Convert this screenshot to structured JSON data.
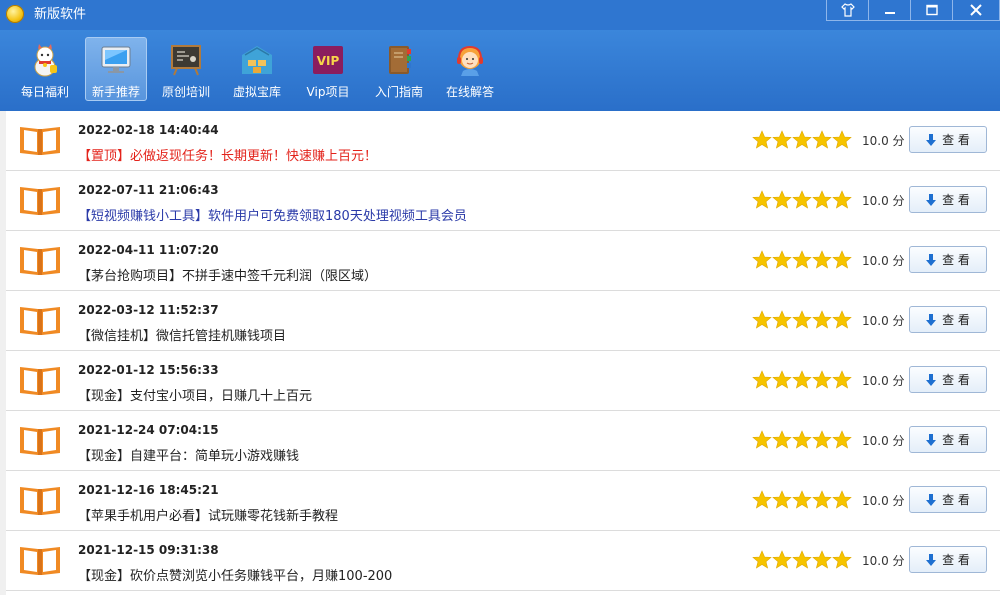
{
  "window": {
    "title": "新版软件",
    "buttons": [
      "skin-icon",
      "minimize-icon",
      "maximize-icon",
      "close-icon"
    ]
  },
  "toolbar": {
    "items": [
      {
        "label": "每日福利",
        "icon": "lucky-cat-icon",
        "active": false
      },
      {
        "label": "新手推荐",
        "icon": "monitor-icon",
        "active": true
      },
      {
        "label": "原创培训",
        "icon": "blackboard-icon",
        "active": false
      },
      {
        "label": "虚拟宝库",
        "icon": "warehouse-icon",
        "active": false
      },
      {
        "label": "Vip项目",
        "icon": "vip-icon",
        "active": false
      },
      {
        "label": "入门指南",
        "icon": "book-stack-icon",
        "active": false
      },
      {
        "label": "在线解答",
        "icon": "support-agent-icon",
        "active": false
      }
    ],
    "vip_text": "VIP"
  },
  "list": {
    "rows": [
      {
        "date": "2022-02-18 14:40:44",
        "title": "【置顶】必做返现任务！长期更新！快速赚上百元！",
        "color": "red",
        "rating": 5,
        "score": "10.0 分",
        "action": "查 看"
      },
      {
        "date": "2022-07-11 21:06:43",
        "title": "【短视频赚钱小工具】软件用户可免费领取180天处理视频工具会员",
        "color": "blue",
        "rating": 5,
        "score": "10.0 分",
        "action": "查 看"
      },
      {
        "date": "2022-04-11 11:07:20",
        "title": "【茅台抢购项目】不拼手速中签千元利润（限区域）",
        "color": "black",
        "rating": 5,
        "score": "10.0 分",
        "action": "查 看"
      },
      {
        "date": "2022-03-12 11:52:37",
        "title": "【微信挂机】微信托管挂机赚钱项目",
        "color": "black",
        "rating": 5,
        "score": "10.0 分",
        "action": "查 看"
      },
      {
        "date": "2022-01-12 15:56:33",
        "title": "【现金】支付宝小项目，日赚几十上百元",
        "color": "black",
        "rating": 5,
        "score": "10.0 分",
        "action": "查 看"
      },
      {
        "date": "2021-12-24 07:04:15",
        "title": "【现金】自建平台：简单玩小游戏赚钱",
        "color": "black",
        "rating": 5,
        "score": "10.0 分",
        "action": "查 看"
      },
      {
        "date": "2021-12-16 18:45:21",
        "title": "【苹果手机用户必看】试玩赚零花钱新手教程",
        "color": "black",
        "rating": 5,
        "score": "10.0 分",
        "action": "查 看"
      },
      {
        "date": "2021-12-15 09:31:38",
        "title": "【现金】砍价点赞浏览小任务赚钱平台，月赚100-200",
        "color": "black",
        "rating": 5,
        "score": "10.0 分",
        "action": "查 看"
      }
    ]
  },
  "colors": {
    "titlebar": "#2f76d0",
    "toolbar": "#2a6fc9",
    "star": "#f6c400",
    "book": "#f08a24",
    "red_title": "#e3231b",
    "blue_title": "#2a3aa8"
  }
}
